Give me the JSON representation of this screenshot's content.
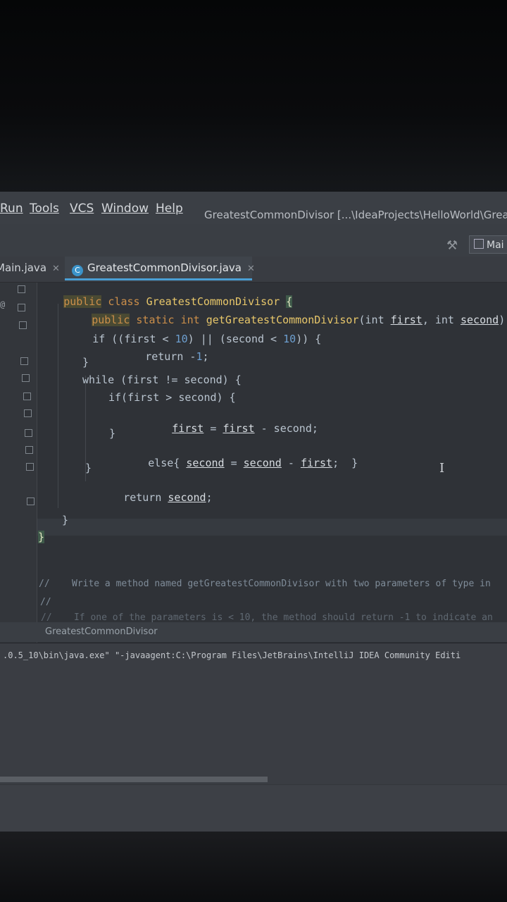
{
  "menu": {
    "run": "Run",
    "tools": "Tools",
    "vcs": "VCS",
    "window": "Window",
    "help": "Help",
    "title": "GreatestCommonDivisor [...\\IdeaProjects\\HelloWorld\\GreatestCon"
  },
  "toolbar": {
    "run_config": "Mai"
  },
  "tabs": [
    {
      "label": "Main.java"
    },
    {
      "label": "GreatestCommonDivisor.java"
    }
  ],
  "code": {
    "l1_kw1": "public",
    "l1_kw2": " class ",
    "l1_name": "GreatestCommonDivisor ",
    "l1_brace": "{",
    "l2_kw1": "public",
    "l2_rest": " static int ",
    "l2_fn": "getGreatestCommonDivisor",
    "l2_open": "(int ",
    "l2_p1": "first",
    "l2_mid": ", int ",
    "l2_p2": "second",
    "l2_close": ") {",
    "l3_a": "if ((first < ",
    "l3_n1": "10",
    "l3_b": ") || (second < ",
    "l3_n2": "10",
    "l3_c": ")) {",
    "l4_a": "return -",
    "l4_n": "1",
    "l4_b": ";",
    "l5": "}",
    "l6": "while (first != second) {",
    "l7": "if(first > second) {",
    "l8_p1": "first",
    "l8_a": " = ",
    "l8_p2": "first",
    "l8_b": " - second;",
    "l9": "}",
    "l10_a": "else{ ",
    "l10_p1": "second",
    "l10_b": " = ",
    "l10_p2": "second",
    "l10_c": " - ",
    "l10_p3": "first",
    "l10_d": ";  }",
    "l11": "}",
    "l12_a": "return ",
    "l12_p": "second",
    "l12_b": ";",
    "l13": "}",
    "l14": "}"
  },
  "comments": {
    "c1": "//    Write a method named getGreatestCommonDivisor with two parameters of type in",
    "c2": "//",
    "c3": "//    If one of the parameters is < 10, the method should return -1 to indicate an"
  },
  "breadcrumb": "GreatestCommonDivisor",
  "run_output": ".0.5_10\\bin\\java.exe\" \"-javaagent:C:\\Program Files\\JetBrains\\IntelliJ IDEA Community Editi"
}
